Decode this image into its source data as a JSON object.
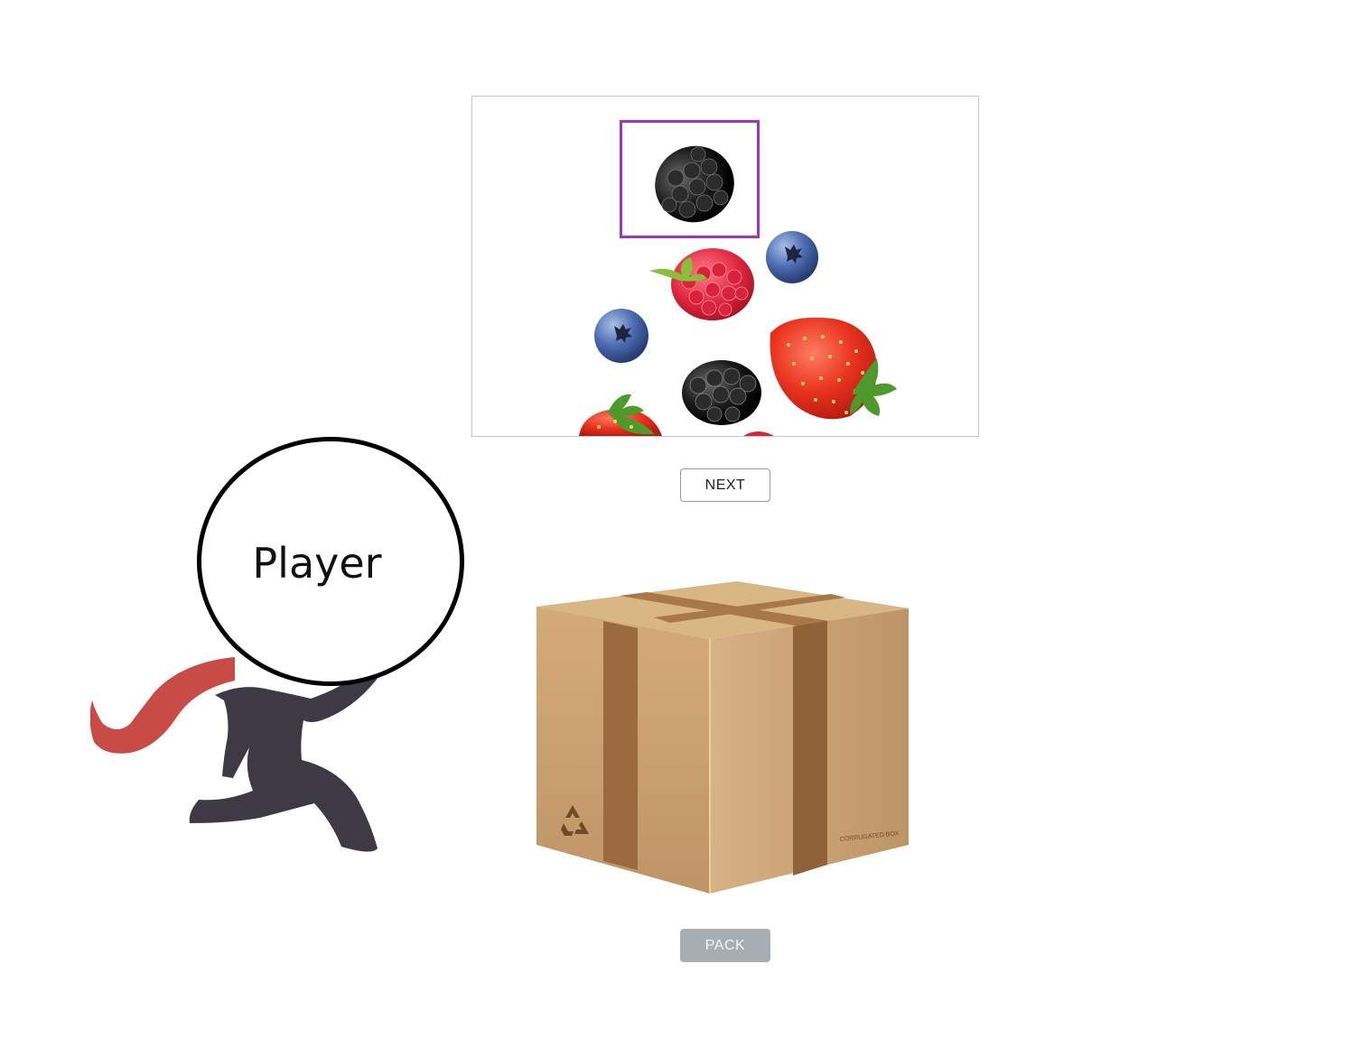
{
  "stage": {
    "items": [
      {
        "kind": "blackberry",
        "selected": true
      },
      {
        "kind": "raspberry"
      },
      {
        "kind": "blueberry"
      },
      {
        "kind": "blueberry"
      },
      {
        "kind": "strawberry"
      },
      {
        "kind": "blackberry"
      },
      {
        "kind": "strawberry"
      }
    ],
    "selection_color": "#9b35c2"
  },
  "buttons": {
    "next_label": "NEXT",
    "pack_label": "PACK",
    "pack_state": "disabled"
  },
  "player": {
    "label": "Player",
    "scarf_color": "#c94b45",
    "body_color": "#3d3a45"
  },
  "box": {
    "printed_text": "CORRUGATED BOX",
    "icon": "recycle-icon"
  }
}
